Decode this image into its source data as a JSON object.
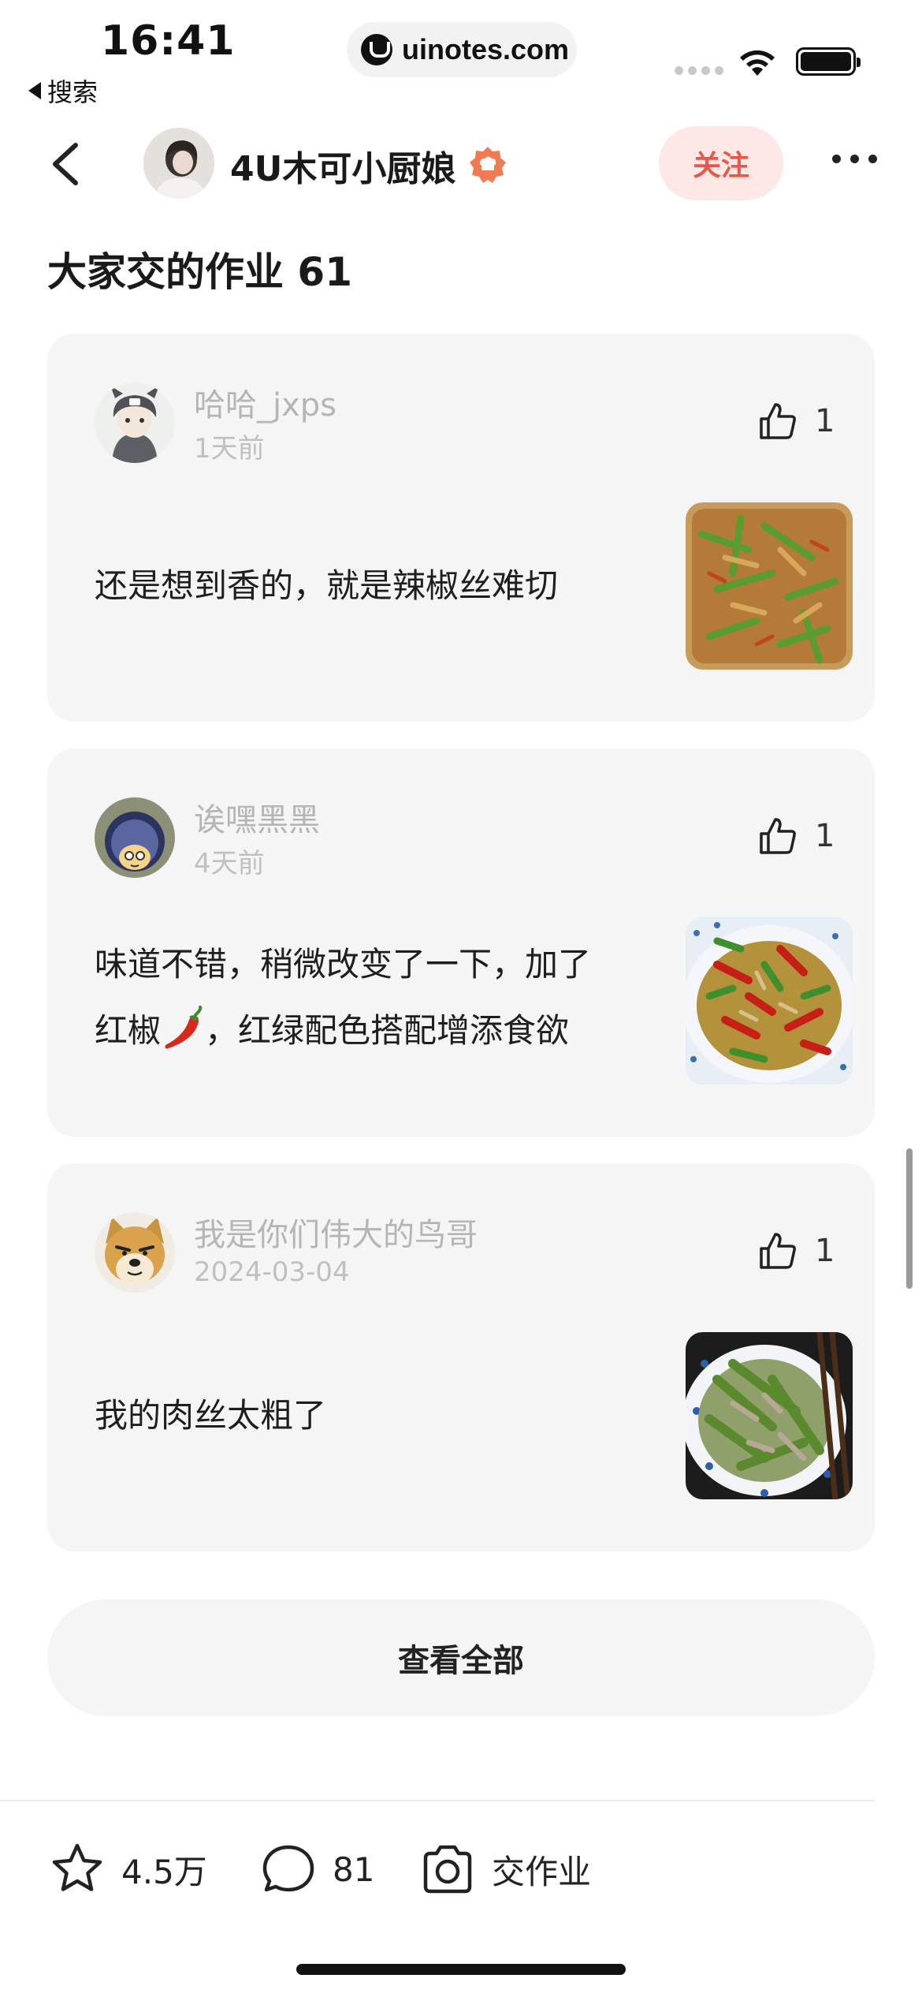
{
  "status_bar": {
    "time": "16:41",
    "back_app": "搜索",
    "url": "uinotes.com"
  },
  "nav": {
    "author_name": "4U木可小厨娘",
    "follow_label": "关注",
    "back_icon": "chevron-left-icon",
    "more_icon": "more-dots-icon",
    "badge_icon": "chef-badge-icon",
    "follow_color": "#e8584a"
  },
  "section": {
    "title": "大家交的作业 61"
  },
  "posts": [
    {
      "username": "哈哈_jxps",
      "date": "1天前",
      "likes": "1",
      "text": "还是想到香的，就是辣椒丝难切",
      "photo": "stir-fry-peppers-photo"
    },
    {
      "username": "诶嘿黑黑",
      "date": "4天前",
      "likes": "1",
      "text_line1": "味道不错，稍微改变了一下，加了",
      "text_line2a": "红椒",
      "text_line2b": "，红绿配色搭配增添食欲",
      "photo": "red-green-pepper-photo"
    },
    {
      "username": "我是你们伟大的鸟哥",
      "date": "2024-03-04",
      "likes": "1",
      "text": "我的肉丝太粗了",
      "photo": "green-beans-pork-photo"
    }
  ],
  "view_all_label": "查看全部",
  "bottom_bar": {
    "favorites": "4.5万",
    "comments": "81",
    "submit_label": "交作业"
  }
}
